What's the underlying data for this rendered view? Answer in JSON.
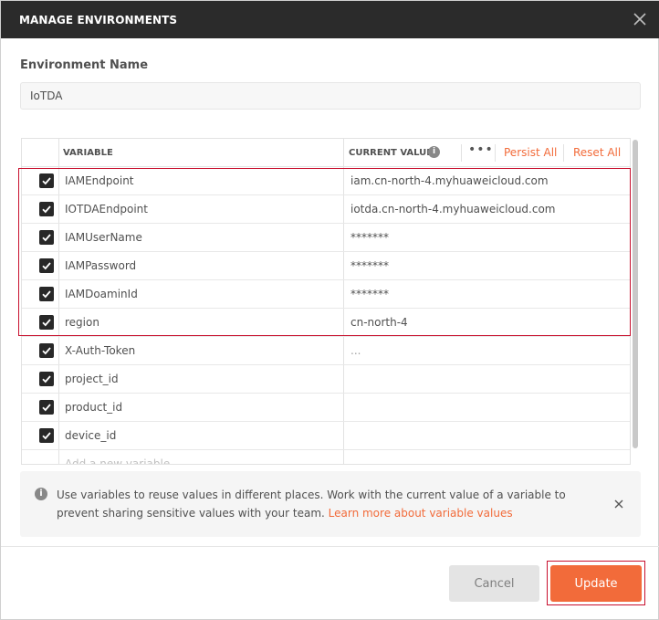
{
  "dialog": {
    "title": "MANAGE ENVIRONMENTS"
  },
  "environment": {
    "label": "Environment Name",
    "name": "IoTDA"
  },
  "table": {
    "headers": {
      "variable": "VARIABLE",
      "current_value": "CURRENT VALUE",
      "info": "i",
      "more": "•••",
      "persist_all": "Persist All",
      "reset_all": "Reset All"
    },
    "rows": [
      {
        "checked": true,
        "variable": "IAMEndpoint",
        "value": "iam.cn-north-4.myhuaweicloud.com"
      },
      {
        "checked": true,
        "variable": "IOTDAEndpoint",
        "value": "iotda.cn-north-4.myhuaweicloud.com"
      },
      {
        "checked": true,
        "variable": "IAMUserName",
        "value": "*******"
      },
      {
        "checked": true,
        "variable": "IAMPassword",
        "value": "*******"
      },
      {
        "checked": true,
        "variable": "IAMDoaminId",
        "value": "*******"
      },
      {
        "checked": true,
        "variable": "region",
        "value": "cn-north-4"
      },
      {
        "checked": true,
        "variable": "X-Auth-Token",
        "value": "..."
      },
      {
        "checked": true,
        "variable": "project_id",
        "value": ""
      },
      {
        "checked": true,
        "variable": "product_id",
        "value": ""
      },
      {
        "checked": true,
        "variable": "device_id",
        "value": ""
      }
    ],
    "add_placeholder": "Add a new variable"
  },
  "info_banner": {
    "icon": "i",
    "text": "Use variables to reuse values in different places. Work with the current value of a variable to prevent sharing sensitive values with your team. ",
    "link": "Learn more about variable values"
  },
  "footer": {
    "cancel_label": "Cancel",
    "update_label": "Update"
  },
  "colors": {
    "titlebar": "#2b2b2b",
    "accent": "#f26b3a",
    "highlight_border": "#c8102e",
    "checkbox": "#282828"
  }
}
